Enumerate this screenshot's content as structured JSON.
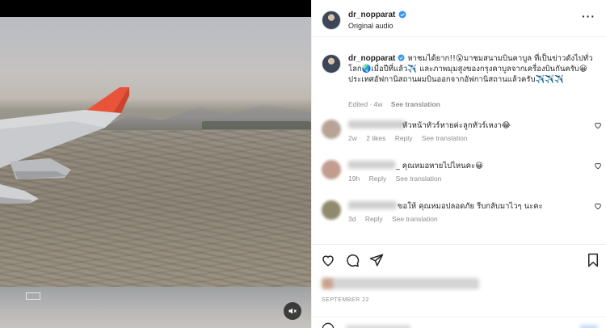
{
  "post": {
    "username": "dr_nopparat",
    "audio_label": "Original audio",
    "more_icon": "more-horizontal-icon",
    "verified_icon": "verified-badge-icon",
    "verified_color": "#3897f0"
  },
  "caption": {
    "username": "dr_nopparat",
    "text": "หาชมได้ยาก!!😮มาชมสนามบินคาบูล ที่เป็นข่าวดังไปทั่วโลก🌏เมื่อปีที่แล้ว✈️ และภาพมุมสูงของกรุงคาบูลจากเครื่องบินกันครับ😀ประเทศอัฟกานิสถานผมบินออกจากอัฟกานิสถานแล้วครับ✈️✈️✈️",
    "meta": {
      "edited": "Edited · 4w",
      "see_translation": "See translation"
    }
  },
  "comments": [
    {
      "text": "หัวหน้าทัวร์หายค่ะลูกทัวร์เหงา😂",
      "time": "2w",
      "likes": "2 likes",
      "reply": "Reply",
      "see_translation": "See translation"
    },
    {
      "text": "_ คุณหมอหายไปไหนคะ😀",
      "time": "19h",
      "reply": "Reply",
      "see_translation": "See translation"
    },
    {
      "text": "ขอให้ คุณหมอปลอดภัย รีบกลับมาไวๆ นะคะ",
      "time": "3d",
      "reply": "Reply",
      "see_translation": "See translation"
    }
  ],
  "actions": {
    "like_icon": "heart-icon",
    "comment_icon": "comment-icon",
    "share_icon": "share-icon",
    "save_icon": "bookmark-icon"
  },
  "date": "SEPTEMBER 22",
  "video": {
    "mute_icon": "speaker-muted-icon",
    "tail_color": "#e8533a"
  }
}
